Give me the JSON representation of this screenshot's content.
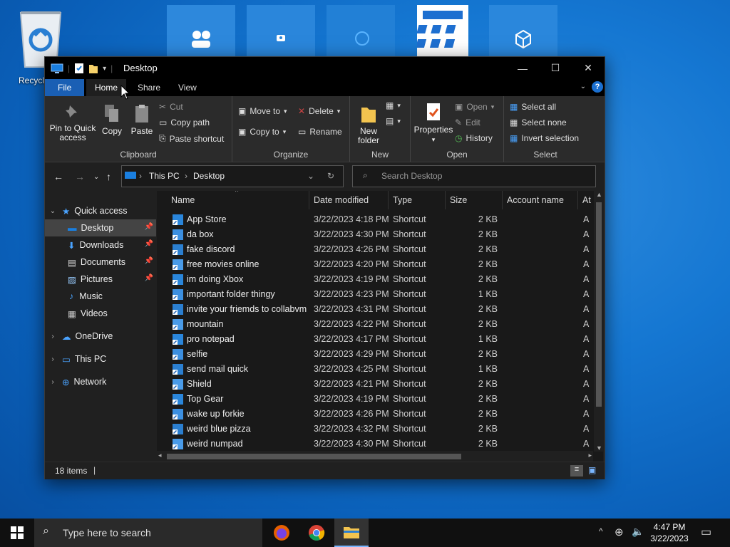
{
  "desktop": {
    "recycle_label": "Recycle"
  },
  "window": {
    "title": "Desktop",
    "controls": {
      "minimize": "—",
      "maximize": "☐",
      "close": "✕"
    },
    "tabs": [
      "File",
      "Home",
      "Share",
      "View"
    ],
    "help": "?"
  },
  "ribbon": {
    "clipboard": {
      "label": "Clipboard",
      "pin": "Pin to Quick access",
      "pin_l1": "Pin to Quick",
      "pin_l2": "access",
      "copy": "Copy",
      "paste": "Paste",
      "cut": "Cut",
      "copy_path": "Copy path",
      "paste_shortcut": "Paste shortcut"
    },
    "organize": {
      "label": "Organize",
      "move_to": "Move to",
      "copy_to": "Copy to",
      "delete": "Delete",
      "rename": "Rename"
    },
    "new": {
      "label": "New",
      "folder_l1": "New",
      "folder_l2": "folder"
    },
    "open": {
      "label": "Open",
      "properties": "Properties",
      "open": "Open",
      "edit": "Edit",
      "history": "History"
    },
    "select": {
      "label": "Select",
      "select_all": "Select all",
      "select_none": "Select none",
      "invert": "Invert selection"
    }
  },
  "address": {
    "crumbs": [
      "This PC",
      "Desktop"
    ],
    "search_placeholder": "Search Desktop"
  },
  "navpane": {
    "quick_access": "Quick access",
    "items": [
      "Desktop",
      "Downloads",
      "Documents",
      "Pictures",
      "Music",
      "Videos"
    ],
    "onedrive": "OneDrive",
    "this_pc": "This PC",
    "network": "Network"
  },
  "list": {
    "columns": [
      "Name",
      "Date modified",
      "Type",
      "Size",
      "Account name",
      "At"
    ],
    "rows": [
      {
        "name": "App Store",
        "date": "3/22/2023 4:18 PM",
        "type": "Shortcut",
        "size": "2 KB",
        "attr": "A"
      },
      {
        "name": "da box",
        "date": "3/22/2023 4:30 PM",
        "type": "Shortcut",
        "size": "2 KB",
        "attr": "A"
      },
      {
        "name": "fake discord",
        "date": "3/22/2023 4:26 PM",
        "type": "Shortcut",
        "size": "2 KB",
        "attr": "A"
      },
      {
        "name": "free movies online",
        "date": "3/22/2023 4:20 PM",
        "type": "Shortcut",
        "size": "2 KB",
        "attr": "A"
      },
      {
        "name": "im doing Xbox",
        "date": "3/22/2023 4:19 PM",
        "type": "Shortcut",
        "size": "2 KB",
        "attr": "A"
      },
      {
        "name": "important folder thingy",
        "date": "3/22/2023 4:23 PM",
        "type": "Shortcut",
        "size": "1 KB",
        "attr": "A"
      },
      {
        "name": "invite your friemds to collabvm",
        "date": "3/22/2023 4:31 PM",
        "type": "Shortcut",
        "size": "2 KB",
        "attr": "A"
      },
      {
        "name": "mountain",
        "date": "3/22/2023 4:22 PM",
        "type": "Shortcut",
        "size": "2 KB",
        "attr": "A"
      },
      {
        "name": "pro notepad",
        "date": "3/22/2023 4:17 PM",
        "type": "Shortcut",
        "size": "1 KB",
        "attr": "A"
      },
      {
        "name": "selfie",
        "date": "3/22/2023 4:29 PM",
        "type": "Shortcut",
        "size": "2 KB",
        "attr": "A"
      },
      {
        "name": "send mail quick",
        "date": "3/22/2023 4:25 PM",
        "type": "Shortcut",
        "size": "1 KB",
        "attr": "A"
      },
      {
        "name": "Shield",
        "date": "3/22/2023 4:21 PM",
        "type": "Shortcut",
        "size": "2 KB",
        "attr": "A"
      },
      {
        "name": "Top Gear",
        "date": "3/22/2023 4:19 PM",
        "type": "Shortcut",
        "size": "2 KB",
        "attr": "A"
      },
      {
        "name": "wake up forkie",
        "date": "3/22/2023 4:26 PM",
        "type": "Shortcut",
        "size": "2 KB",
        "attr": "A"
      },
      {
        "name": "weird blue pizza",
        "date": "3/22/2023 4:32 PM",
        "type": "Shortcut",
        "size": "2 KB",
        "attr": "A"
      },
      {
        "name": "weird numpad",
        "date": "3/22/2023 4:30 PM",
        "type": "Shortcut",
        "size": "2 KB",
        "attr": "A"
      }
    ]
  },
  "status": {
    "items": "18 items"
  },
  "taskbar": {
    "search_placeholder": "Type here to search",
    "time": "4:47 PM",
    "date": "3/22/2023"
  },
  "colors": {
    "accent": "#1a5fb4",
    "window_bg": "#202020",
    "ribbon_bg": "#2b2b2b"
  }
}
